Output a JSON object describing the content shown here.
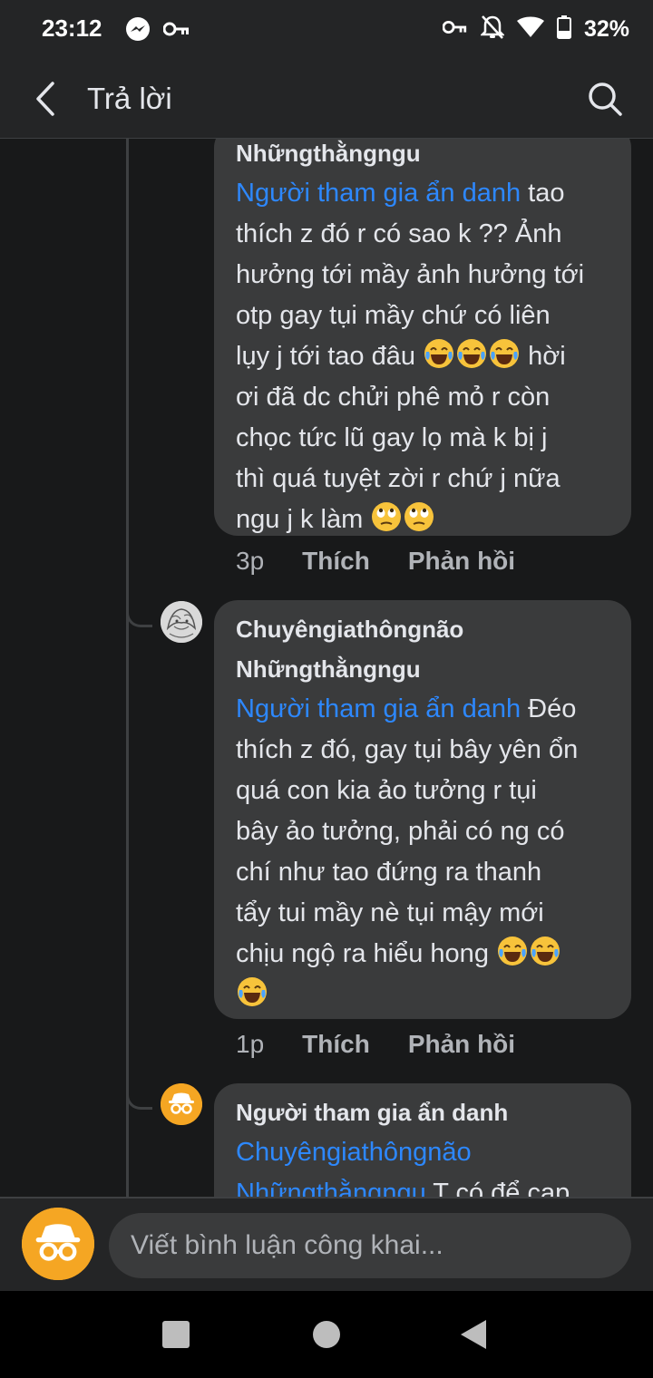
{
  "status_bar": {
    "time": "23:12",
    "battery": "32%",
    "left_icons": [
      "messenger-icon",
      "key-icon"
    ],
    "right_icons": [
      "key-icon",
      "bell-off-icon",
      "wifi-icon",
      "battery-icon"
    ]
  },
  "app_bar": {
    "title": "Trả lời",
    "back_icon": "chevron-left-icon",
    "search_icon": "search-icon"
  },
  "comments": [
    {
      "author_line": "Nhữngthằngngu",
      "mention": "Người tham gia ẩn danh",
      "text_lines": [
        " tao",
        "thích z đó r có sao k ?? Ảnh",
        "hưởng tới mầy ảnh hưởng tới",
        "otp gay tụi mầy chứ có liên",
        "lụy j tới tao đâu ",
        " hời",
        "ơi đã dc chửi phê mỏ r còn",
        "chọc tức lũ gay lọ mà k bị j",
        "thì quá tuyệt zời r chứ j nữa",
        "ngu j k làm "
      ],
      "time": "3p",
      "like": "Thích",
      "reply": "Phản hồi"
    },
    {
      "author": "Chuyêngiathôngnão",
      "author_line": "Nhữngthằngngu",
      "mention": "Người tham gia ẩn danh",
      "text_lines": [
        " Đéo",
        "thích z đó, gay tụi bây yên ổn",
        "quá con kia ảo tưởng r tụi",
        "bây ảo tưởng, phải có ng có",
        "chí như tao đứng ra thanh",
        "tẩy tui mầy nè tụi mậy mới",
        "chịu ngộ ra hiểu hong "
      ],
      "time": "1p",
      "like": "Thích",
      "reply": "Phản hồi"
    },
    {
      "author": "Người tham gia ẩn danh",
      "mention_1": "Chuyêngiathôngnão",
      "mention_2": "Nhữngthằngngu",
      "text": " T có để cap"
    }
  ],
  "comment_bar": {
    "placeholder": "Viết bình luận công khai..."
  },
  "colors": {
    "background": "#18191a",
    "bubble": "#3a3b3c",
    "mention": "#2d88ff",
    "secondary_text": "#b0b3b8",
    "anon_avatar": "#f5a623"
  }
}
